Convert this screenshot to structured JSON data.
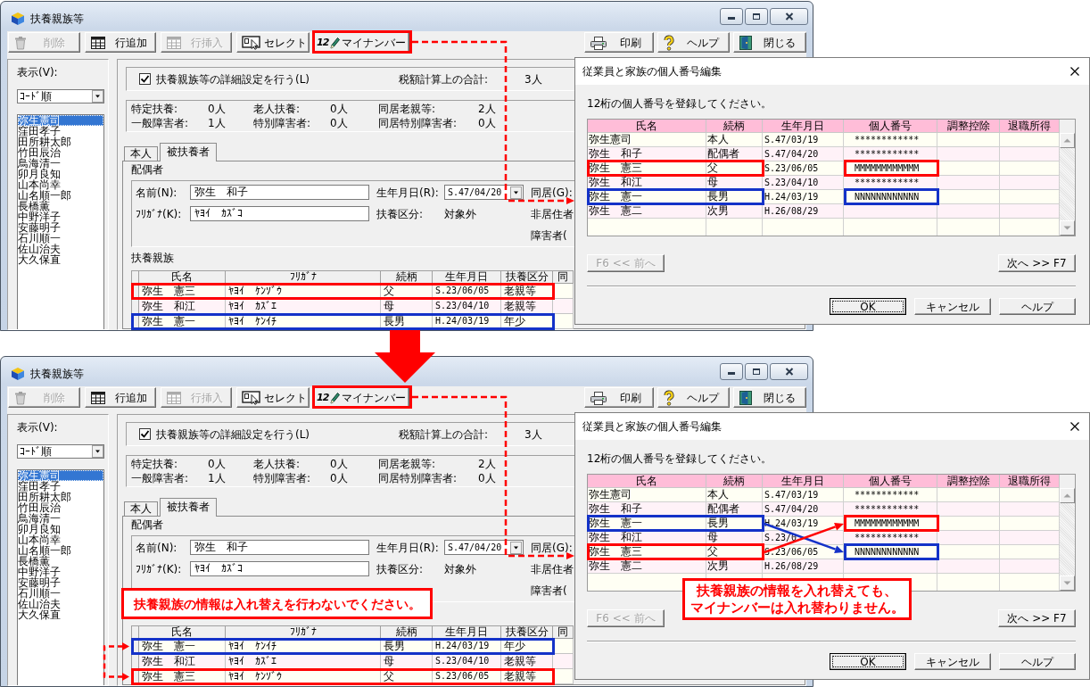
{
  "panels": [
    {
      "window": {
        "title": "扶養親族等",
        "toolbar_left": [
          {
            "kind": "delete",
            "label": "削除",
            "disabled": true
          },
          {
            "kind": "add-row",
            "label": "行追加",
            "disabled": false
          },
          {
            "kind": "insert-row",
            "label": "行挿入",
            "disabled": true
          },
          {
            "kind": "select",
            "label": "セレクト",
            "disabled": false
          },
          {
            "kind": "my-number",
            "icon_text": "12",
            "label": "マイナンバー",
            "disabled": false,
            "highlight": {
              "color": "#ff0000"
            }
          }
        ],
        "toolbar_right": [
          {
            "kind": "print",
            "label": "印刷",
            "disabled": false
          },
          {
            "kind": "help",
            "label": "ヘルプ",
            "disabled": false
          },
          {
            "kind": "close",
            "label": "閉じる",
            "disabled": false
          }
        ],
        "view": {
          "label": "表示(V):",
          "sort_order": "ｺｰﾄﾞ順"
        },
        "employees": [
          {
            "name": "弥生憲司",
            "selected": true
          },
          {
            "name": "窪田孝子",
            "selected": false
          },
          {
            "name": "田所耕太郎",
            "selected": false
          },
          {
            "name": "竹田辰治",
            "selected": false
          },
          {
            "name": "鳥海清一",
            "selected": false
          },
          {
            "name": "卯月良知",
            "selected": false
          },
          {
            "name": "山本尚幸",
            "selected": false
          },
          {
            "name": "山名順一郎",
            "selected": false
          },
          {
            "name": "長橋薫",
            "selected": false
          },
          {
            "name": "中野洋子",
            "selected": false
          },
          {
            "name": "安藤明子",
            "selected": false
          },
          {
            "name": "石川順一",
            "selected": false
          },
          {
            "name": "佐山治夫",
            "selected": false
          },
          {
            "name": "大久保直",
            "selected": false
          }
        ],
        "detail_setting": {
          "label": "扶養親族等の詳細設定を行う(L)",
          "checked": true
        },
        "tax_total": {
          "label": "税額計算上の合計:",
          "value": "3人"
        },
        "counts": [
          {
            "label": "特定扶養:",
            "value": "0人"
          },
          {
            "label": "老人扶養:",
            "value": "0人"
          },
          {
            "label": "同居老親等:",
            "value": "2人"
          },
          {
            "label": "一般障害者:",
            "value": "1人"
          },
          {
            "label": "特別障害者:",
            "value": "0人"
          },
          {
            "label": "同居特別障害者:",
            "value": "0人"
          }
        ],
        "tabs": [
          {
            "label": "本人",
            "selected": false
          },
          {
            "label": "被扶養者",
            "selected": true
          }
        ],
        "spouse": {
          "title": "配偶者",
          "name": {
            "label": "名前(N):",
            "value": "弥生　和子"
          },
          "birth_date": {
            "label": "生年月日(R):",
            "value": "S.47/04/20"
          },
          "living_together": {
            "label": "同居(G):"
          },
          "furigana": {
            "label": "ﾌﾘｶﾞﾅ(K):",
            "value": "ﾔﾖｲ　ｶｽﾞｺ"
          },
          "dependent_type": {
            "label": "扶養区分:",
            "value": "対象外"
          },
          "non_resident": {
            "label": "非居住者"
          },
          "disability": {
            "label": "障害者("
          }
        },
        "dependents": {
          "title": "扶養親族",
          "columns": [
            "氏名",
            "ﾌﾘｶﾞﾅ",
            "続柄",
            "生年月日",
            "扶養区分",
            "同"
          ],
          "rows": [
            {
              "name": "弥生　憲三",
              "furigana": "ﾔﾖｲ　ｹﾝｿﾞｳ",
              "relation": "父",
              "birth_date": "S.23/06/05",
              "type": "老親等",
              "highlight": {
                "color": "#ff0000"
              }
            },
            {
              "name": "弥生　和江",
              "furigana": "ﾔﾖｲ　ｶｽﾞｴ",
              "relation": "母",
              "birth_date": "S.23/04/10",
              "type": "老親等"
            },
            {
              "name": "弥生　憲一",
              "furigana": "ﾔﾖｲ　ｹﾝｲﾁ",
              "relation": "長男",
              "birth_date": "H.24/03/19",
              "type": "年少",
              "highlight": {
                "color": "#1432c8"
              }
            }
          ]
        }
      },
      "dialog": {
        "title": "従業員と家族の個人番号編集",
        "instruction": "12桁の個人番号を登録してください。",
        "columns": [
          "氏名",
          "続柄",
          "生年月日",
          "個人番号",
          "調整控除",
          "退職所得"
        ],
        "rows": [
          {
            "name": "弥生憲司",
            "relation": "本人",
            "birth_date": "S.47/03/19",
            "number": "************"
          },
          {
            "name": "弥生　和子",
            "relation": "配偶者",
            "birth_date": "S.47/04/20",
            "number": "************"
          },
          {
            "name": "弥生　憲三",
            "relation": "父",
            "birth_date": "S.23/06/05",
            "number": "MMMMMMMMMMMM",
            "highlights": [
              {
                "kind": "name",
                "color": "#ff0000"
              },
              {
                "kind": "number",
                "color": "#ff0000"
              }
            ]
          },
          {
            "name": "弥生　和江",
            "relation": "母",
            "birth_date": "S.23/04/10",
            "number": "************"
          },
          {
            "name": "弥生　憲一",
            "relation": "長男",
            "birth_date": "H.24/03/19",
            "number": "NNNNNNNNNNNN",
            "highlights": [
              {
                "kind": "name",
                "color": "#1432c8"
              },
              {
                "kind": "number",
                "color": "#1432c8"
              }
            ]
          },
          {
            "name": "弥生　憲二",
            "relation": "次男",
            "birth_date": "H.26/08/29"
          }
        ],
        "nav_buttons": [
          {
            "kind": "prev",
            "label": "F6 << 前へ",
            "disabled": true
          },
          {
            "kind": "next",
            "label": "次へ >> F7",
            "disabled": false
          }
        ],
        "action_buttons": [
          {
            "kind": "ok",
            "label": "OK",
            "focused": true
          },
          {
            "kind": "cancel",
            "label": "キャンセル",
            "focused": false
          },
          {
            "kind": "help",
            "label": "ヘルプ",
            "focused": false
          }
        ]
      },
      "annotations": {
        "connector": true
      }
    },
    {
      "window": {
        "title": "扶養親族等",
        "toolbar_left": [
          {
            "kind": "delete",
            "label": "削除",
            "disabled": true
          },
          {
            "kind": "add-row",
            "label": "行追加",
            "disabled": false
          },
          {
            "kind": "insert-row",
            "label": "行挿入",
            "disabled": true
          },
          {
            "kind": "select",
            "label": "セレクト",
            "disabled": false
          },
          {
            "kind": "my-number",
            "icon_text": "12",
            "label": "マイナンバー",
            "disabled": false,
            "highlight": {
              "color": "#ff0000"
            }
          }
        ],
        "toolbar_right": [
          {
            "kind": "print",
            "label": "印刷",
            "disabled": false
          },
          {
            "kind": "help",
            "label": "ヘルプ",
            "disabled": false
          },
          {
            "kind": "close",
            "label": "閉じる",
            "disabled": false
          }
        ],
        "view": {
          "label": "表示(V):",
          "sort_order": "ｺｰﾄﾞ順"
        },
        "employees": [
          {
            "name": "弥生憲司",
            "selected": true
          },
          {
            "name": "窪田孝子",
            "selected": false
          },
          {
            "name": "田所耕太郎",
            "selected": false
          },
          {
            "name": "竹田辰治",
            "selected": false
          },
          {
            "name": "鳥海清一",
            "selected": false
          },
          {
            "name": "卯月良知",
            "selected": false
          },
          {
            "name": "山本尚幸",
            "selected": false
          },
          {
            "name": "山名順一郎",
            "selected": false
          },
          {
            "name": "長橋薫",
            "selected": false
          },
          {
            "name": "中野洋子",
            "selected": false
          },
          {
            "name": "安藤明子",
            "selected": false
          },
          {
            "name": "石川順一",
            "selected": false
          },
          {
            "name": "佐山治夫",
            "selected": false
          },
          {
            "name": "大久保直",
            "selected": false
          }
        ],
        "detail_setting": {
          "label": "扶養親族等の詳細設定を行う(L)",
          "checked": true
        },
        "tax_total": {
          "label": "税額計算上の合計:",
          "value": "3人"
        },
        "counts": [
          {
            "label": "特定扶養:",
            "value": "0人"
          },
          {
            "label": "老人扶養:",
            "value": "0人"
          },
          {
            "label": "同居老親等:",
            "value": "2人"
          },
          {
            "label": "一般障害者:",
            "value": "1人"
          },
          {
            "label": "特別障害者:",
            "value": "0人"
          },
          {
            "label": "同居特別障害者:",
            "value": "0人"
          }
        ],
        "tabs": [
          {
            "label": "本人",
            "selected": false
          },
          {
            "label": "被扶養者",
            "selected": true
          }
        ],
        "spouse": {
          "title": "配偶者",
          "name": {
            "label": "名前(N):",
            "value": "弥生　和子"
          },
          "birth_date": {
            "label": "生年月日(R):",
            "value": "S.47/04/20"
          },
          "living_together": {
            "label": "同居(G):"
          },
          "furigana": {
            "label": "ﾌﾘｶﾞﾅ(K):",
            "value": "ﾔﾖｲ　ｶｽﾞｺ"
          },
          "dependent_type": {
            "label": "扶養区分:",
            "value": "対象外"
          },
          "non_resident": {
            "label": "非居住者"
          },
          "disability": {
            "label": "障害者("
          }
        },
        "dependents": {
          "columns": [
            "氏名",
            "ﾌﾘｶﾞﾅ",
            "続柄",
            "生年月日",
            "扶養区分",
            "同"
          ],
          "rows": [
            {
              "name": "弥生　憲一",
              "furigana": "ﾔﾖｲ　ｹﾝｲﾁ",
              "relation": "長男",
              "birth_date": "H.24/03/19",
              "type": "年少",
              "highlight": {
                "color": "#1432c8"
              }
            },
            {
              "name": "弥生　和江",
              "furigana": "ﾔﾖｲ　ｶｽﾞｴ",
              "relation": "母",
              "birth_date": "S.23/04/10",
              "type": "老親等"
            },
            {
              "name": "弥生　憲三",
              "furigana": "ﾔﾖｲ　ｹﾝｿﾞｳ",
              "relation": "父",
              "birth_date": "S.23/06/05",
              "type": "老親等",
              "highlight": {
                "color": "#ff0000"
              }
            }
          ]
        }
      },
      "dialog": {
        "title": "従業員と家族の個人番号編集",
        "instruction": "12桁の個人番号を登録してください。",
        "columns": [
          "氏名",
          "続柄",
          "生年月日",
          "個人番号",
          "調整控除",
          "退職所得"
        ],
        "rows": [
          {
            "name": "弥生憲司",
            "relation": "本人",
            "birth_date": "S.47/03/19",
            "number": "************"
          },
          {
            "name": "弥生　和子",
            "relation": "配偶者",
            "birth_date": "S.47/04/20",
            "number": "************"
          },
          {
            "name": "弥生　憲一",
            "relation": "長男",
            "birth_date": "H.24/03/19",
            "number": "MMMMMMMMMMMM",
            "highlights": [
              {
                "kind": "name",
                "color": "#1432c8"
              },
              {
                "kind": "number",
                "color": "#ff0000"
              }
            ]
          },
          {
            "name": "弥生　和江",
            "relation": "母",
            "birth_date": "S.23/0",
            "number": "************"
          },
          {
            "name": "弥生　憲三",
            "relation": "父",
            "birth_date": "S.23/06/05",
            "number": "NNNNNNNNNNNN",
            "highlights": [
              {
                "kind": "name",
                "color": "#ff0000"
              },
              {
                "kind": "number",
                "color": "#1432c8"
              }
            ]
          },
          {
            "name": "弥生　憲二",
            "relation": "次男",
            "birth_date": "H.26/08/29"
          }
        ],
        "nav_buttons": [
          {
            "kind": "prev",
            "label": "F6 << 前へ",
            "disabled": true
          },
          {
            "kind": "next",
            "label": "次へ >> F7",
            "disabled": false
          }
        ],
        "action_buttons": [
          {
            "kind": "ok",
            "label": "OK",
            "focused": true
          },
          {
            "kind": "cancel",
            "label": "キャンセル",
            "focused": false
          },
          {
            "kind": "help",
            "label": "ヘルプ",
            "focused": false
          }
        ]
      },
      "annotations": {
        "connector": true,
        "swap_arrow": true,
        "cross_arrows": true
      },
      "callouts": [
        {
          "kind": "window",
          "lines": [
            "扶養親族の情報は入れ替えを行わないでください。"
          ]
        },
        {
          "kind": "dialog",
          "lines": [
            "扶養親族の情報を入れ替えても、",
            "マイナンバーは入れ替わりません。"
          ]
        }
      ]
    }
  ]
}
